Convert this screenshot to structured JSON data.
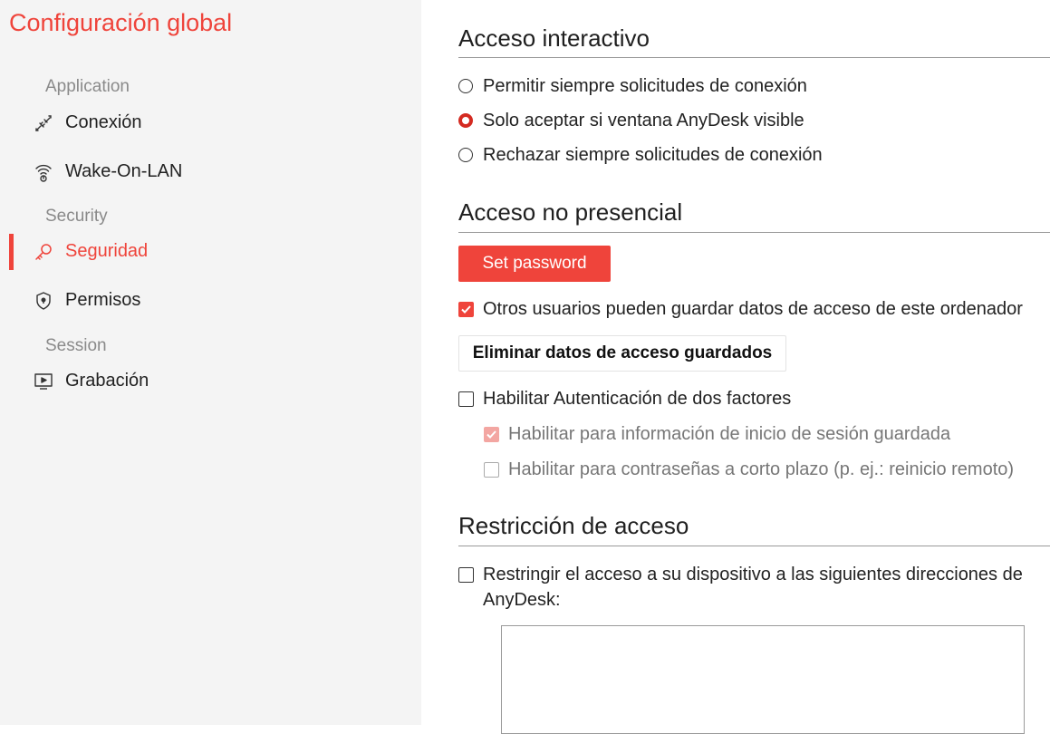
{
  "app": {
    "title": "Configuración global"
  },
  "sidebar": {
    "sections": {
      "application": "Application",
      "security": "Security",
      "session": "Session"
    },
    "items": [
      {
        "label": "Conexión",
        "icon": "connection-icon"
      },
      {
        "label": "Wake-On-LAN",
        "icon": "wifi-signal-icon"
      },
      {
        "label": "Seguridad",
        "icon": "key-icon",
        "active": true
      },
      {
        "label": "Permisos",
        "icon": "shield-icon"
      },
      {
        "label": "Grabación",
        "icon": "screen-record-icon"
      }
    ]
  },
  "main": {
    "interactive": {
      "heading": "Acceso interactivo",
      "options": [
        {
          "label": "Permitir siempre solicitudes de conexión",
          "selected": false
        },
        {
          "label": "Solo aceptar si ventana AnyDesk visible",
          "selected": true
        },
        {
          "label": "Rechazar siempre solicitudes de conexión",
          "selected": false
        }
      ]
    },
    "unattended": {
      "heading": "Acceso no presencial",
      "set_password": "Set password",
      "save_access_label": "Otros usuarios pueden guardar datos de acceso de este ordenador",
      "save_access_checked": true,
      "delete_button": "Eliminar datos de acceso guardados",
      "twofa_label": "Habilitar Autenticación de dos factores",
      "twofa_checked": false,
      "twofa_saved_label": "Habilitar para información de inicio de sesión guardada",
      "twofa_saved_checked": true,
      "twofa_short_label": "Habilitar para contraseñas a corto plazo (p. ej.: reinicio remoto)",
      "twofa_short_checked": false
    },
    "restriction": {
      "heading": "Restricción de acceso",
      "restrict_label_line1": "Restringir el acceso a su dispositivo a las siguientes direcciones de",
      "restrict_label_line2": "AnyDesk:",
      "restrict_checked": false,
      "addresses_value": ""
    }
  },
  "colors": {
    "accent": "#ef443b",
    "sidebar_bg": "#f4f4f4"
  }
}
